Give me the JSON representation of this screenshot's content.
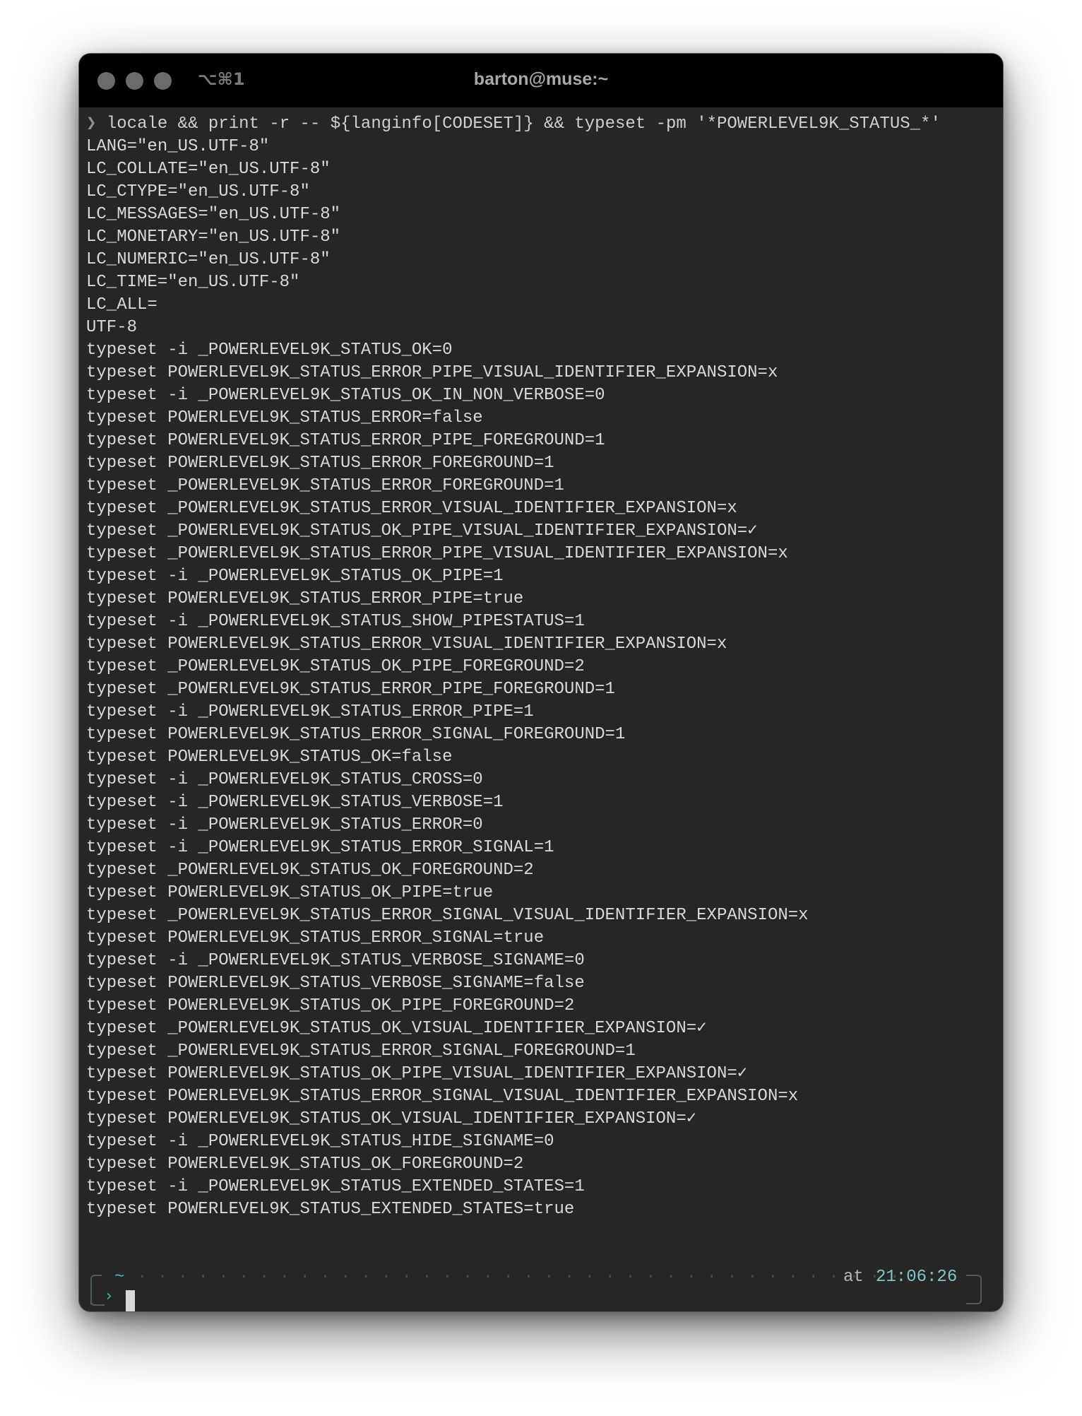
{
  "window": {
    "title": "barton@muse:~",
    "shortcut": "⌥⌘1"
  },
  "terminal": {
    "prompt_glyph": "❯",
    "command": "locale && print -r -- ${langinfo[CODESET]} && typeset -pm '*POWERLEVEL9K_STATUS_*'",
    "output_lines": [
      "LANG=\"en_US.UTF-8\"",
      "LC_COLLATE=\"en_US.UTF-8\"",
      "LC_CTYPE=\"en_US.UTF-8\"",
      "LC_MESSAGES=\"en_US.UTF-8\"",
      "LC_MONETARY=\"en_US.UTF-8\"",
      "LC_NUMERIC=\"en_US.UTF-8\"",
      "LC_TIME=\"en_US.UTF-8\"",
      "LC_ALL=",
      "UTF-8",
      "typeset -i _POWERLEVEL9K_STATUS_OK=0",
      "typeset POWERLEVEL9K_STATUS_ERROR_PIPE_VISUAL_IDENTIFIER_EXPANSION=x",
      "typeset -i _POWERLEVEL9K_STATUS_OK_IN_NON_VERBOSE=0",
      "typeset POWERLEVEL9K_STATUS_ERROR=false",
      "typeset POWERLEVEL9K_STATUS_ERROR_PIPE_FOREGROUND=1",
      "typeset POWERLEVEL9K_STATUS_ERROR_FOREGROUND=1",
      "typeset _POWERLEVEL9K_STATUS_ERROR_FOREGROUND=1",
      "typeset _POWERLEVEL9K_STATUS_ERROR_VISUAL_IDENTIFIER_EXPANSION=x",
      "typeset _POWERLEVEL9K_STATUS_OK_PIPE_VISUAL_IDENTIFIER_EXPANSION=✓",
      "typeset _POWERLEVEL9K_STATUS_ERROR_PIPE_VISUAL_IDENTIFIER_EXPANSION=x",
      "typeset -i _POWERLEVEL9K_STATUS_OK_PIPE=1",
      "typeset POWERLEVEL9K_STATUS_ERROR_PIPE=true",
      "typeset -i _POWERLEVEL9K_STATUS_SHOW_PIPESTATUS=1",
      "typeset POWERLEVEL9K_STATUS_ERROR_VISUAL_IDENTIFIER_EXPANSION=x",
      "typeset _POWERLEVEL9K_STATUS_OK_PIPE_FOREGROUND=2",
      "typeset _POWERLEVEL9K_STATUS_ERROR_PIPE_FOREGROUND=1",
      "typeset -i _POWERLEVEL9K_STATUS_ERROR_PIPE=1",
      "typeset POWERLEVEL9K_STATUS_ERROR_SIGNAL_FOREGROUND=1",
      "typeset POWERLEVEL9K_STATUS_OK=false",
      "typeset -i _POWERLEVEL9K_STATUS_CROSS=0",
      "typeset -i _POWERLEVEL9K_STATUS_VERBOSE=1",
      "typeset -i _POWERLEVEL9K_STATUS_ERROR=0",
      "typeset -i _POWERLEVEL9K_STATUS_ERROR_SIGNAL=1",
      "typeset _POWERLEVEL9K_STATUS_OK_FOREGROUND=2",
      "typeset POWERLEVEL9K_STATUS_OK_PIPE=true",
      "typeset _POWERLEVEL9K_STATUS_ERROR_SIGNAL_VISUAL_IDENTIFIER_EXPANSION=x",
      "typeset POWERLEVEL9K_STATUS_ERROR_SIGNAL=true",
      "typeset -i _POWERLEVEL9K_STATUS_VERBOSE_SIGNAME=0",
      "typeset POWERLEVEL9K_STATUS_VERBOSE_SIGNAME=false",
      "typeset POWERLEVEL9K_STATUS_OK_PIPE_FOREGROUND=2",
      "typeset _POWERLEVEL9K_STATUS_OK_VISUAL_IDENTIFIER_EXPANSION=✓",
      "typeset _POWERLEVEL9K_STATUS_ERROR_SIGNAL_FOREGROUND=1",
      "typeset POWERLEVEL9K_STATUS_OK_PIPE_VISUAL_IDENTIFIER_EXPANSION=✓",
      "typeset POWERLEVEL9K_STATUS_ERROR_SIGNAL_VISUAL_IDENTIFIER_EXPANSION=x",
      "typeset POWERLEVEL9K_STATUS_OK_VISUAL_IDENTIFIER_EXPANSION=✓",
      "typeset -i _POWERLEVEL9K_STATUS_HIDE_SIGNAME=0",
      "typeset POWERLEVEL9K_STATUS_OK_FOREGROUND=2",
      "typeset -i _POWERLEVEL9K_STATUS_EXTENDED_STATES=1",
      "typeset POWERLEVEL9K_STATUS_EXTENDED_STATES=true"
    ]
  },
  "prompt": {
    "directory": "~",
    "at_label": "at",
    "time": "21:06:26",
    "input_glyph": "›"
  },
  "colors": {
    "background": "#262626",
    "titlebar": "#000000",
    "text": "#d8d8d8",
    "accent": "#49b6c0",
    "time": "#7ec7c7"
  },
  "icons": {
    "traffic_lights": [
      "close-button-icon",
      "minimize-button-icon",
      "zoom-button-icon"
    ],
    "cursor": "block-cursor-icon"
  }
}
